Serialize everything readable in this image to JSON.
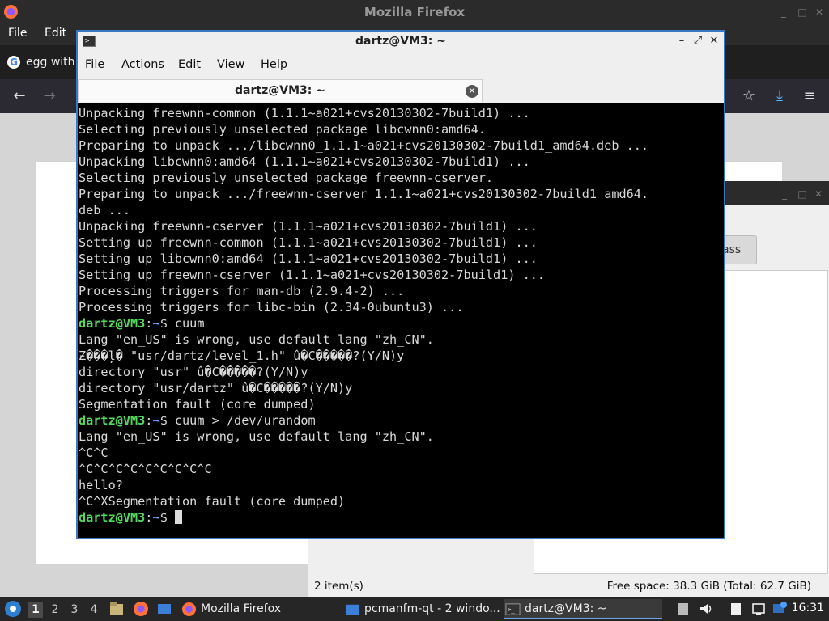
{
  "firefox": {
    "title": "Mozilla Firefox",
    "menu": [
      "File",
      "Edit"
    ],
    "tab_label": "egg with"
  },
  "filemanager": {
    "button_fragment": "ass",
    "status_items": "2 item(s)",
    "status_free": "Free space: 38.3 GiB (Total: 62.7 GiB)"
  },
  "terminal": {
    "title": "dartz@VM3: ~",
    "menu": [
      "File",
      "Actions",
      "Edit",
      "View",
      "Help"
    ],
    "tab_label": "dartz@VM3: ~",
    "prompt_user": "dartz@VM3",
    "prompt_path": "~",
    "lines": [
      {
        "t": "Unpacking freewnn-common (1.1.1~a021+cvs20130302-7build1) ..."
      },
      {
        "t": "Selecting previously unselected package libcwnn0:amd64."
      },
      {
        "t": "Preparing to unpack .../libcwnn0_1.1.1~a021+cvs20130302-7build1_amd64.deb ..."
      },
      {
        "t": "Unpacking libcwnn0:amd64 (1.1.1~a021+cvs20130302-7build1) ..."
      },
      {
        "t": "Selecting previously unselected package freewnn-cserver."
      },
      {
        "t": "Preparing to unpack .../freewnn-cserver_1.1.1~a021+cvs20130302-7build1_amd64."
      },
      {
        "t": "deb ..."
      },
      {
        "t": "Unpacking freewnn-cserver (1.1.1~a021+cvs20130302-7build1) ..."
      },
      {
        "t": "Setting up freewnn-common (1.1.1~a021+cvs20130302-7build1) ..."
      },
      {
        "t": "Setting up libcwnn0:amd64 (1.1.1~a021+cvs20130302-7build1) ..."
      },
      {
        "t": "Setting up freewnn-cserver (1.1.1~a021+cvs20130302-7build1) ..."
      },
      {
        "t": "Processing triggers for man-db (2.9.4-2) ..."
      },
      {
        "t": "Processing triggers for libc-bin (2.34-0ubuntu3) ..."
      },
      {
        "p": true,
        "t": "$ cuum"
      },
      {
        "t": "Lang \"en_US\" is wrong, use default lang \"zh_CN\"."
      },
      {
        "t": "Ƶ���ļ� \"usr/dartz/level_1.h\" û�C�����?(Y/N)y"
      },
      {
        "t": "directory \"usr\" û�C�����?(Y/N)y"
      },
      {
        "t": "directory \"usr/dartz\" û�C�����?(Y/N)y"
      },
      {
        "t": "Segmentation fault (core dumped)"
      },
      {
        "p": true,
        "t": "$ cuum > /dev/urandom"
      },
      {
        "t": "Lang \"en_US\" is wrong, use default lang \"zh_CN\"."
      },
      {
        "t": "^C^C"
      },
      {
        "t": "^C^C^C^C^C^C^C^C^C"
      },
      {
        "t": "hello?"
      },
      {
        "t": "^C^XSegmentation fault (core dumped)"
      },
      {
        "p": true,
        "t": "$ ",
        "cursor": true
      }
    ]
  },
  "taskbar": {
    "workspaces": [
      "1",
      "2",
      "3",
      "4"
    ],
    "tasks": [
      {
        "label": "Mozilla Firefox"
      },
      {
        "label": "pcmanfm-qt - 2 windo..."
      },
      {
        "label": "dartz@VM3: ~"
      }
    ],
    "clock": "16:31"
  },
  "colors": {
    "terminal_bg": "#000000",
    "prompt_user": "#54d85e",
    "prompt_path": "#6c9fff",
    "window_border": "#3a78c4"
  }
}
